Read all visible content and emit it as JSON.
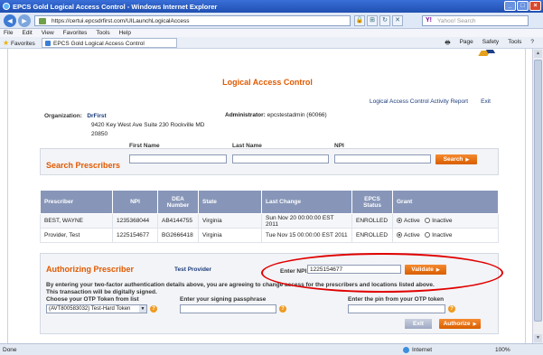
{
  "window": {
    "title": "EPCS Gold Logical Access Control - Windows Internet Explorer"
  },
  "browser": {
    "url": "https://certui.epcsdrfirst.com/UILaunchLogicalAccess",
    "search_placeholder": "Yahoo! Search",
    "menu": [
      "File",
      "Edit",
      "View",
      "Favorites",
      "Tools",
      "Help"
    ],
    "favorites_label": "Favorites",
    "tab_label": "EPCS Gold Logical Access Control",
    "tools": [
      "Page",
      "Safety",
      "Tools"
    ]
  },
  "page": {
    "title": "Logical Access Control",
    "links": [
      "Logical Access Control Activity Report",
      "Exit"
    ],
    "org_label": "Organization:",
    "org_name": "DrFirst",
    "org_address1": "9420 Key West Ave Suite 230 Rockville MD",
    "org_address2": "20850",
    "admin_label": "Administrator:",
    "admin_value": "epcstestadmin (60066)"
  },
  "search": {
    "title": "Search Prescribers",
    "first_name_label": "First Name",
    "last_name_label": "Last Name",
    "npi_label": "NPI",
    "button": "Search"
  },
  "table": {
    "headers": [
      "Prescriber",
      "NPI",
      "DEA Number",
      "State",
      "Last Change",
      "EPCS Status",
      "Grant"
    ],
    "rows": [
      {
        "prescriber": "BEST, WAYNE",
        "npi": "1235368044",
        "dea": "AB4144755",
        "state": "Virginia",
        "last_change": "Sun Nov 20 00:00:00 EST 2011",
        "status": "ENROLLED",
        "grant": "Active"
      },
      {
        "prescriber": "Provider, Test",
        "npi": "1225154677",
        "dea": "BG2666418",
        "state": "Virginia",
        "last_change": "Tue Nov 15 00:00:00 EST 2011",
        "status": "ENROLLED",
        "grant": "Active"
      }
    ],
    "grant_options": [
      "Active",
      "Inactive"
    ]
  },
  "auth": {
    "title": "Authorizing Prescriber",
    "prescriber_name": "Test Provider",
    "npi_label": "Enter NPI:",
    "npi_value": "1225154677",
    "validate_button": "Validate",
    "notice1": "By entering your two-factor authentication details above, you are agreeing to change access for the prescribers and locations listed above.",
    "notice2": "This transaction will be digitally signed.",
    "otp_token_label": "Choose your OTP Token from list",
    "otp_token_value": "(AVT800583032) Test-Hard Token",
    "passphrase_label": "Enter your signing passphrase",
    "pin_label": "Enter the pin from your OTP token",
    "exit_button": "Exit",
    "authorize_button": "Authorize"
  },
  "status": {
    "left": "Done",
    "zone": "Internet",
    "zoom": "100%"
  },
  "colors": {
    "accent": "#e05a00",
    "header": "#8796b8",
    "highlight": "#e00000"
  }
}
